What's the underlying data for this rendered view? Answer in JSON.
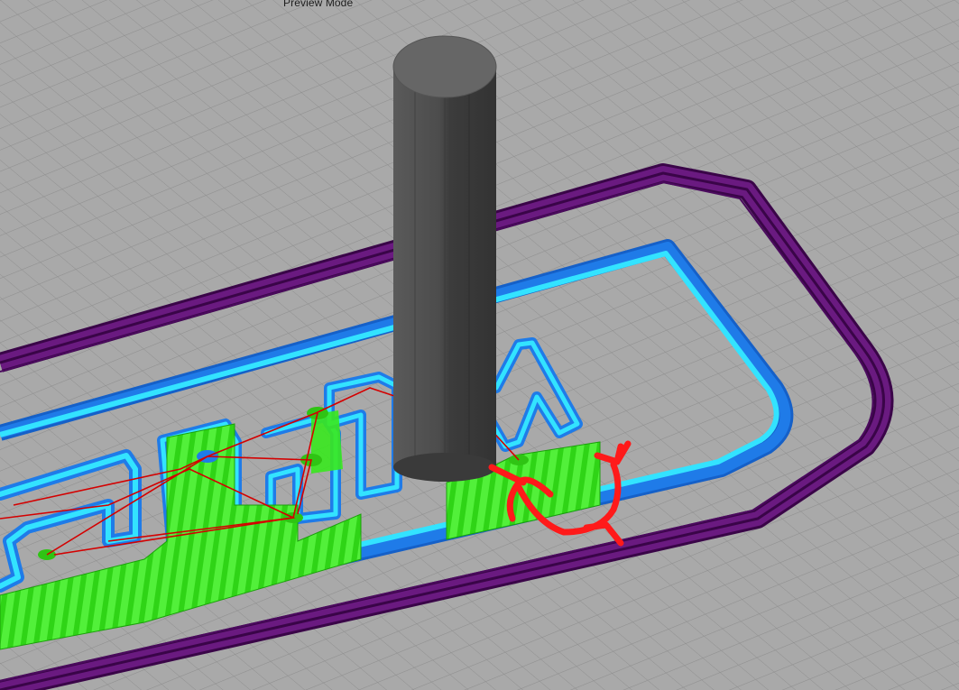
{
  "view": {
    "mode_label": "Preview Mode"
  },
  "colors": {
    "build_plate": "#a9a9a9",
    "grid_line": "#8e8e8e",
    "skirt": "#5a0a6e",
    "outer_wall": "#1f7be8",
    "inner_wall": "#33e3ff",
    "infill": "#38e81e",
    "travel": "#d40000",
    "nozzle": "#464646",
    "annotation": "#ff1a1a"
  },
  "layer_features": [
    "skirt",
    "outer-wall",
    "inner-wall",
    "infill",
    "travel-moves",
    "nozzle",
    "annotation"
  ]
}
